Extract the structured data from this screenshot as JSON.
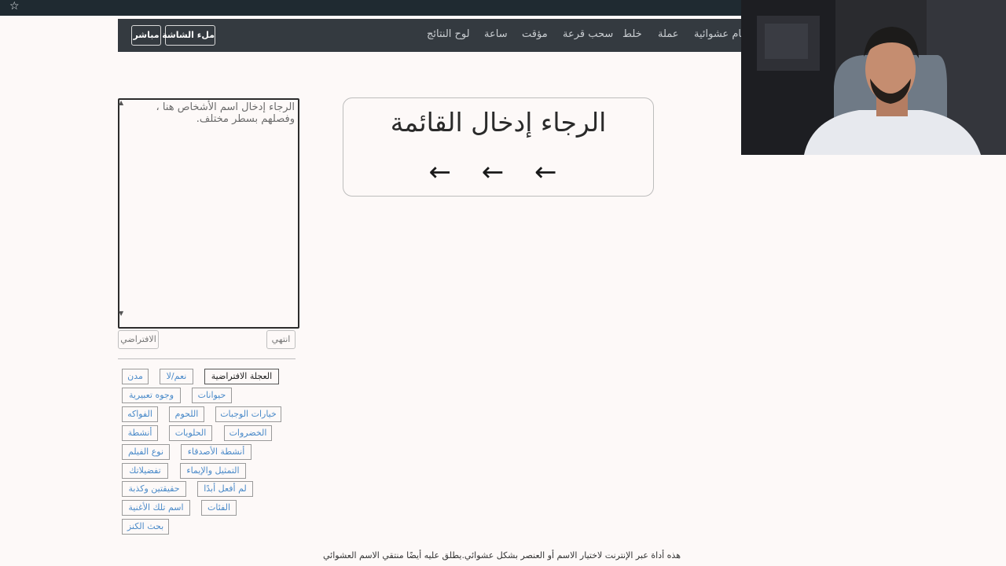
{
  "browser": {
    "bookmark_icon": "star-outline-icon"
  },
  "nav": {
    "buttons": [
      "مباشر",
      "ملء الشاشة"
    ],
    "links": [
      "لوح النتائج",
      "ساعة",
      "مؤقت",
      "سحب قرعة",
      "خلط",
      "عملة",
      "أرقام عشوائية"
    ]
  },
  "names_input": {
    "placeholder": "الرجاء إدخال اسم الأشخاص هنا ، وفصلهم بسطر مختلف.",
    "value": ""
  },
  "actions": {
    "default_label": "الافتراضي",
    "done_label": "انتهي"
  },
  "presets": [
    "العجلة الافتراضية",
    "نعم/لا",
    "مدن",
    "حيوانات",
    "وجوه تعبيرية",
    "خيارات الوجبات",
    "اللحوم",
    "الفواكه",
    "الخضروات",
    "الحلويات",
    "أنشطة",
    "أنشطة الأصدقاء",
    "نوع الفيلم",
    "التمثيل والإيماء",
    "تفضيلاتك",
    "لم أفعل أبدًا",
    "حقيقتين وكذبة",
    "الفئات",
    "اسم تلك الأغنية",
    "بحث الكنز"
  ],
  "result": {
    "message": "الرجاء إدخال القائمة",
    "arrows": "← ← ←"
  },
  "footer": {
    "description": "هذه أداة عبر الإنترنت لاختيار الاسم أو العنصر بشكل عشوائي.يطلق عليه أيضًا منتقي الاسم العشوائي"
  },
  "colors": {
    "nav_bg": "#343a40",
    "tag_text": "#4a8ac9",
    "page_bg": "#fdf9f8"
  }
}
